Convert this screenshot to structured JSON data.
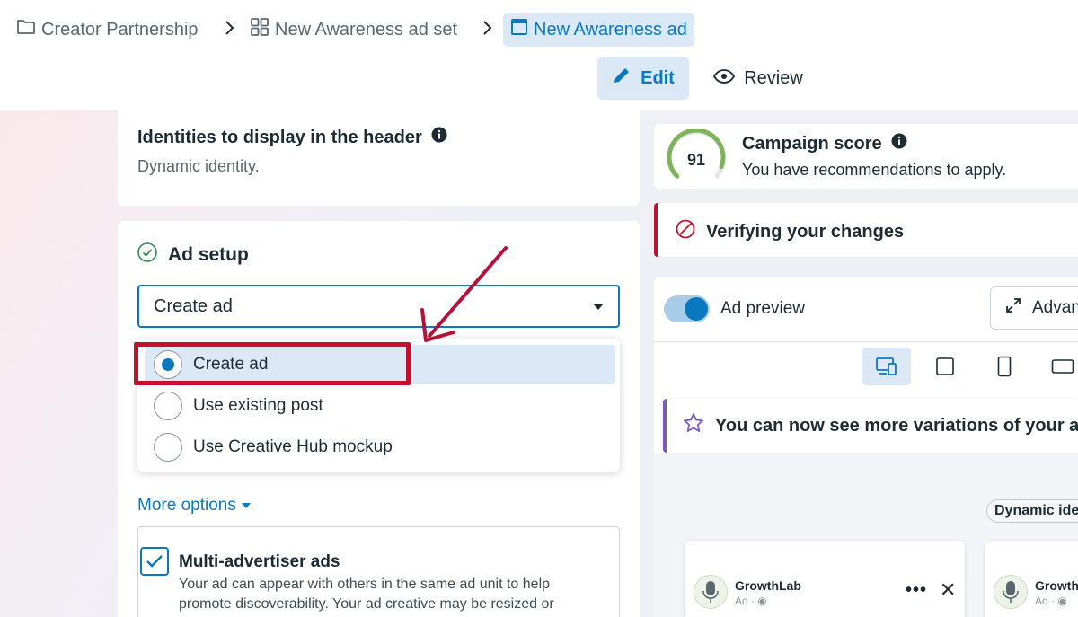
{
  "breadcrumb": {
    "campaign": "Creator Partnership",
    "ad_set": "New Awareness ad set",
    "ad": "New Awareness ad"
  },
  "toolbar": {
    "edit_label": "Edit",
    "review_label": "Review"
  },
  "identities": {
    "title": "Identities to display in the header",
    "subtitle": "Dynamic identity."
  },
  "ad_setup": {
    "title": "Ad setup",
    "select_value": "Create ad",
    "options": [
      {
        "label": "Create ad",
        "selected": true
      },
      {
        "label": "Use existing post",
        "selected": false
      },
      {
        "label": "Use Creative Hub mockup",
        "selected": false
      }
    ],
    "more_options": "More options",
    "multi_advertiser": {
      "title": "Multi-advertiser ads",
      "checked": true,
      "description": "Your ad can appear with others in the same ad unit to help promote discoverability. Your ad creative may be resized or"
    }
  },
  "campaign_score": {
    "score": "91",
    "score_fraction": 0.91,
    "title": "Campaign score",
    "subtitle": "You have recommendations to apply."
  },
  "verification": {
    "text": "Verifying your changes"
  },
  "preview": {
    "toggle_label": "Ad preview",
    "toggle_on": true,
    "advanced_label": "Advanced preview",
    "variations_notice": "You can now see more variations of your ad",
    "dynamic_badge": "Dynamic identity",
    "ads": [
      {
        "name": "GrowthLab",
        "meta": "Ad · ◉"
      },
      {
        "name": "GrowthLab",
        "meta": "Ad · ◉"
      }
    ]
  },
  "colors": {
    "accent": "#0a78be",
    "accent_light": "#dbe9f7",
    "error": "#c4102d",
    "score_green": "#7fb35a",
    "variation_purple": "#7e57c2"
  },
  "icons": {
    "campaign": "folder-icon",
    "ad_set": "grid-icon",
    "ad": "ad-window-icon",
    "edit": "pencil-icon",
    "review": "eye-icon",
    "info": "info-icon",
    "setup_status": "check-circle-icon",
    "verify_status": "blocked-icon",
    "expand": "expand-icon",
    "star": "star-icon"
  }
}
